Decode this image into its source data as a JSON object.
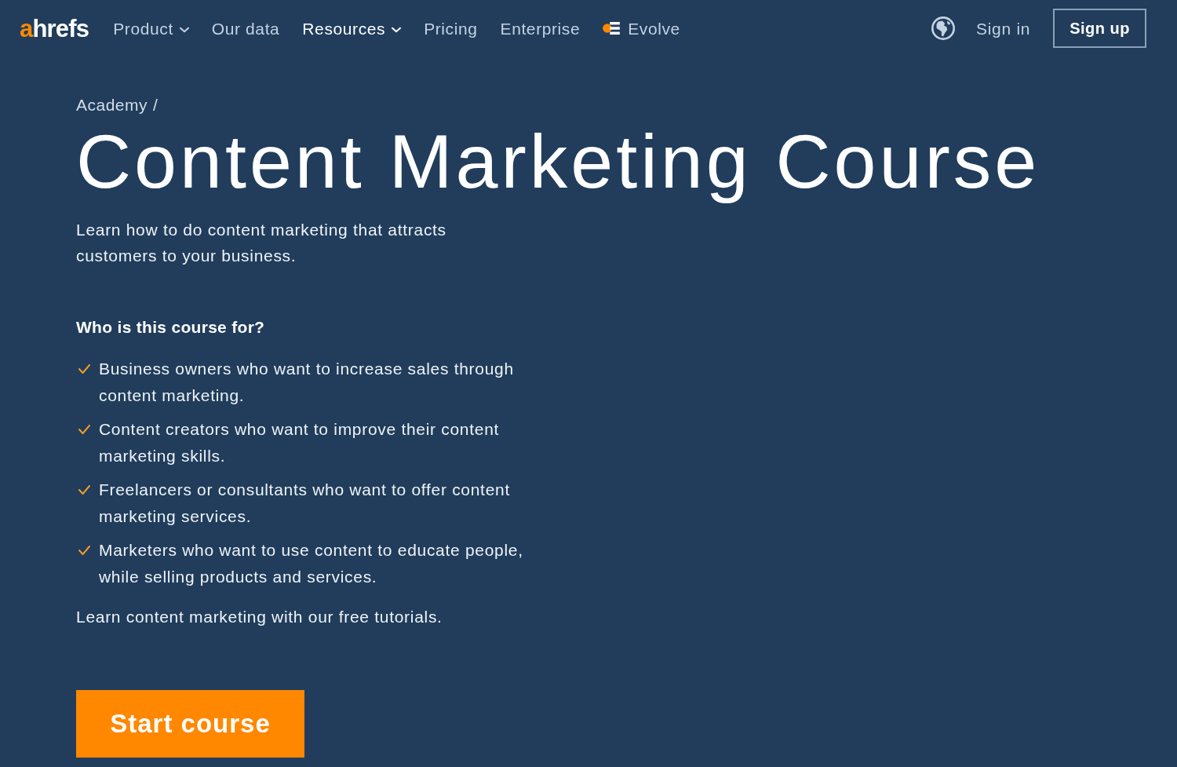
{
  "header": {
    "logo": {
      "accent": "a",
      "rest": "hrefs"
    },
    "nav": [
      {
        "label": "Product",
        "kind": "link",
        "has_menu": true,
        "selected": false
      },
      {
        "label": "Our data",
        "kind": "link",
        "has_menu": false,
        "selected": false
      },
      {
        "label": "Resources",
        "kind": "link",
        "has_menu": true,
        "selected": true
      },
      {
        "label": "Pricing",
        "kind": "link",
        "has_menu": false,
        "selected": false
      },
      {
        "label": "Enterprise",
        "kind": "link",
        "has_menu": false,
        "selected": false
      },
      {
        "label": "Evolve",
        "kind": "brand",
        "has_menu": false,
        "selected": false
      }
    ],
    "sign_in": "Sign in",
    "sign_up": "Sign up"
  },
  "breadcrumb": {
    "items": [
      "Academy"
    ],
    "separator": "/"
  },
  "title": "Content Marketing Course",
  "description": "Learn how to do content marketing that attracts customers to your business.",
  "audience": {
    "heading": "Who is this course for?",
    "items": [
      "Business owners who want to increase sales through content marketing.",
      "Content creators who want to improve their content marketing skills.",
      "Freelancers or consultants who want to offer content marketing services.",
      "Marketers who want to use content to educate people, while selling products and services."
    ]
  },
  "closing": "Learn content marketing with our free tutorials.",
  "cta": "Start course"
}
